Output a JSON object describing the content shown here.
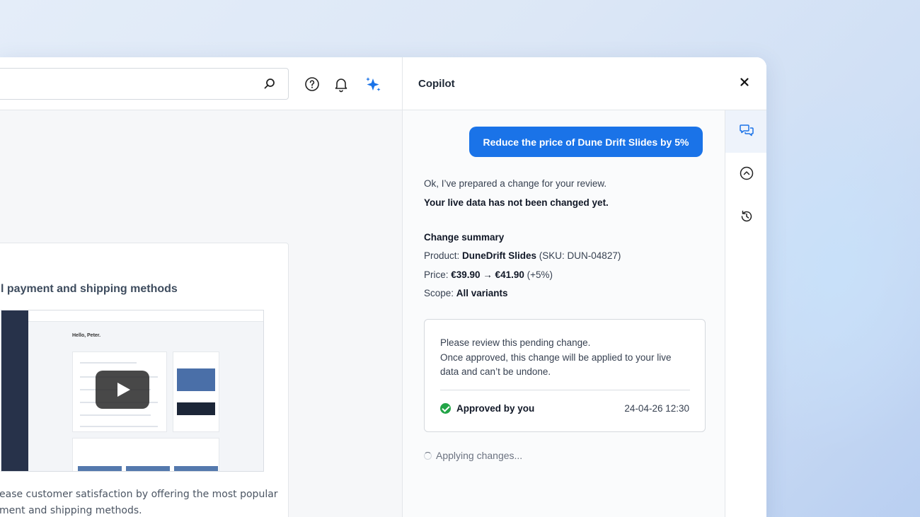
{
  "app": {
    "search": {
      "placeholder": ""
    },
    "icons": {
      "help": "help-circle-icon",
      "notifications": "bell-icon",
      "copilot": "sparkles-icon"
    },
    "card": {
      "title": "l payment and shipping methods",
      "video_hello": "Hello, Peter.",
      "description": "ease customer satisfaction by offering the most popular\nment and shipping methods."
    }
  },
  "copilot": {
    "title": "Copilot",
    "user_message": "Reduce the price of Dune Drift Slides by 5%",
    "reply_line1": "Ok, I’ve prepared a change for your review.",
    "reply_line2": "Your live data has not been changed yet.",
    "summary": {
      "heading": "Change summary",
      "product_label": "Product: ",
      "product_name": "DuneDrift Slides",
      "product_sku": " (SKU: DUN-04827)",
      "price_label": "Price: ",
      "price_change": "€39.90 → €41.90",
      "price_pct": " (+5%)",
      "scope_label": "Scope: ",
      "scope_value": "All variants"
    },
    "review": {
      "line1": "Please review this pending change.",
      "line2": "Once approved, this change will be applied to your live",
      "line3": "data and can’t be undone.",
      "status": "Approved by you",
      "timestamp": "24-04-26 12:30"
    },
    "applying": "Applying changes...",
    "rail_icons": [
      "chat-bubbles-icon",
      "chevron-up-circle-icon",
      "history-icon"
    ],
    "colors": {
      "accent": "#1a73e8",
      "success": "#22a447"
    }
  }
}
